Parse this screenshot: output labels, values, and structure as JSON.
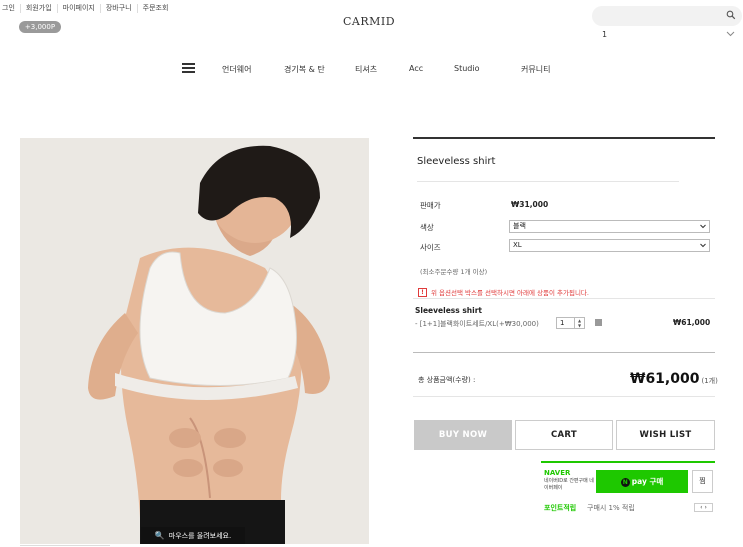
{
  "top_links": [
    "그인",
    "회원가입",
    "마이페이지",
    "장바구니",
    "주문조회"
  ],
  "point_badge": "+3,000P",
  "brand": "CARMID",
  "search": {
    "placeholder": ""
  },
  "cart_count": "1",
  "nav": [
    "언더웨어",
    "경기복 & 탄",
    "티셔츠",
    "Acc",
    "Studio",
    "커뮤니티"
  ],
  "image": {
    "zoom_hint": "마우스를 올려보세요."
  },
  "product": {
    "name": "Sleeveless shirt",
    "price_label": "판매가",
    "price": "₩31,000",
    "color_label": "색상",
    "color_value": "블랙",
    "size_label": "사이즈",
    "size_value": "XL",
    "min_order": "(최소주문수량 1개 이상)",
    "notice": "위 옵션선택 박스를 선택하시면 아래에 상품이 추가됩니다."
  },
  "selected_item": {
    "name": "Sleeveless shirt",
    "option": "- [1+1]블랙화이트세트/XL(+₩30,000)",
    "quantity": "1",
    "price": "₩61,000"
  },
  "total": {
    "label": "총 상품금액(수량) :",
    "amount": "₩61,000",
    "count": "(1개)"
  },
  "buttons": {
    "buy_now": "BUY NOW",
    "cart": "CART",
    "wish_list": "WISH LIST"
  },
  "naver": {
    "logo": "NAVER",
    "desc": "네이버ID로 간편구매 네이버페이",
    "pay_label": "pay 구매",
    "zzim_label": "찜",
    "point_label": "포인트적립",
    "point_desc": "구매시 1% 적립"
  }
}
